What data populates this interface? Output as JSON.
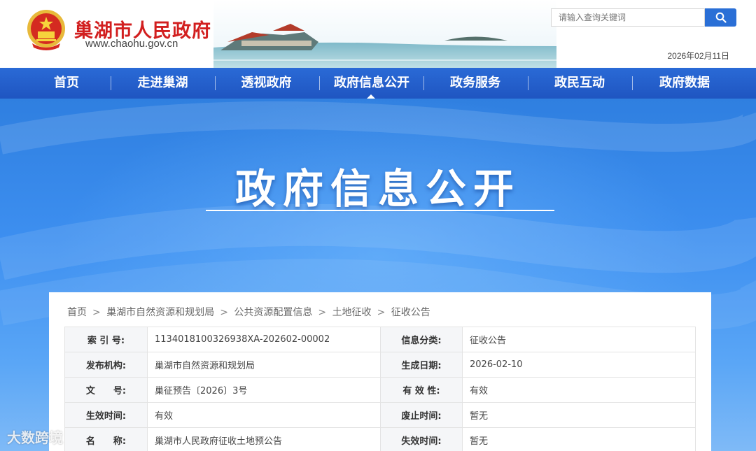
{
  "header": {
    "site_title": "巢湖市人民政府",
    "site_url": "www.chaohu.gov.cn",
    "search_placeholder": "请输入查询关键词",
    "date": "2026年02月11日"
  },
  "nav": {
    "items": [
      "首页",
      "走进巢湖",
      "透视政府",
      "政府信息公开",
      "政务服务",
      "政民互动",
      "政府数据"
    ],
    "active": "政府信息公开"
  },
  "banner": {
    "title": "政府信息公开"
  },
  "breadcrumb": [
    "首页",
    "巢湖市自然资源和规划局",
    "公共资源配置信息",
    "土地征收",
    "征收公告"
  ],
  "info_rows": [
    {
      "label1": "索 引 号:",
      "value1": "1134018100326938XA-202602-00002",
      "label2": "信息分类:",
      "value2": "征收公告"
    },
    {
      "label1": "发布机构:",
      "value1": "巢湖市自然资源和规划局",
      "label2": "生成日期:",
      "value2": "2026-02-10"
    },
    {
      "label1": "文　　号:",
      "value1": "巢征预告〔2026〕3号",
      "label2": "有 效 性:",
      "value2": "有效"
    },
    {
      "label1": "生效时间:",
      "value1": "有效",
      "label2": "废止时间:",
      "value2": "暂无"
    },
    {
      "label1": "名　　称:",
      "value1": "巢湖市人民政府征收土地预公告",
      "label2": "失效时间:",
      "value2": "暂无"
    }
  ],
  "watermark": "大数跨境",
  "colors": {
    "nav": "#2162cc",
    "title_red": "#d21f1f",
    "search_button": "#2a6fd6"
  }
}
